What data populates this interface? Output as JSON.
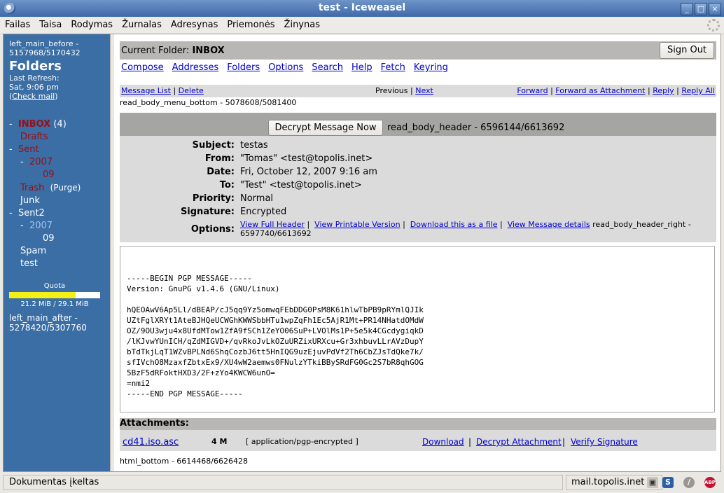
{
  "window": {
    "title": "test - Iceweasel"
  },
  "menubar": [
    "Failas",
    "Taisa",
    "Rodymas",
    "Žurnalas",
    "Adresynas",
    "Priemonės",
    "Žinynas"
  ],
  "left": {
    "debug_before": "left_main_before - 5157968/5170432",
    "title": "Folders",
    "last_refresh_label": "Last Refresh:",
    "last_refresh_value": "Sat, 9:06 pm",
    "check_mail_open": "(",
    "check_mail": "Check mail",
    "check_mail_close": ")",
    "folders": [
      {
        "prefix": "-",
        "name": "INBOX",
        "count": "(4)",
        "style": "redbold",
        "indent": 0
      },
      {
        "prefix": "",
        "name": "Drafts",
        "style": "red",
        "indent": 0
      },
      {
        "prefix": "-",
        "name": "Sent",
        "style": "red",
        "indent": 0
      },
      {
        "prefix": "-",
        "name": "2007",
        "style": "red",
        "indent": 1
      },
      {
        "prefix": "",
        "name": "09",
        "style": "red",
        "indent": 2
      },
      {
        "prefix": "",
        "name": "Trash",
        "extra": "(Purge)",
        "style": "red",
        "indent": 0
      },
      {
        "prefix": "",
        "name": "Junk",
        "style": "white",
        "indent": 0
      },
      {
        "prefix": "-",
        "name": "Sent2",
        "style": "white",
        "indent": 0
      },
      {
        "prefix": "-",
        "name": "2007",
        "style": "blueish",
        "indent": 1
      },
      {
        "prefix": "",
        "name": "09",
        "style": "white",
        "indent": 2
      },
      {
        "prefix": "",
        "name": "Spam",
        "style": "white",
        "indent": 0
      },
      {
        "prefix": "",
        "name": "test",
        "style": "white",
        "indent": 0
      }
    ],
    "quota_label": "Quota",
    "quota_fraction": 0.73,
    "quota_text": "21.2 MiB / 29.1 MiB",
    "debug_after": "left_main_after - 5278420/5307760"
  },
  "header": {
    "current_folder_label": "Current Folder:",
    "current_folder": "INBOX",
    "sign_out": "Sign Out"
  },
  "nav": [
    "Compose",
    "Addresses",
    "Folders",
    "Options",
    "Search",
    "Help",
    "Fetch",
    "Keyring"
  ],
  "msgbar": {
    "message_list": "Message List",
    "delete": "Delete",
    "previous": "Previous",
    "next": "Next",
    "forward": "Forward",
    "forward_attachment": "Forward as Attachment",
    "reply": "Reply",
    "reply_all": "Reply All",
    "sep": "|"
  },
  "debug_menu_bottom": "read_body_menu_bottom - 5078608/5081400",
  "decrypt_button": "Decrypt Message Now",
  "debug_read_body_header": "read_body_header - 6596144/6613692",
  "headers": {
    "subject_label": "Subject:",
    "subject": "testas",
    "from_label": "From:",
    "from": "\"Tomas\" <test@topolis.inet>",
    "date_label": "Date:",
    "date": "Fri, October 12, 2007 9:16 am",
    "to_label": "To:",
    "to": "\"Test\" <test@topolis.inet>",
    "priority_label": "Priority:",
    "priority": "Normal",
    "signature_label": "Signature:",
    "signature": "Encrypted",
    "options_label": "Options:",
    "view_full_header": "View Full Header",
    "view_printable": "View Printable Version",
    "download_file": "Download this as a file",
    "view_details": "View Message details",
    "debug_header_right": "read_body_header_right - 6597740/6613692"
  },
  "body_text": "-----BEGIN PGP MESSAGE-----\nVersion: GnuPG v1.4.6 (GNU/Linux)\n\nhQEOAwV6Ap5Ll/dBEAP/cJ5qq9Yz5omwqFEbDDG0PsM8K61hlwTbPB9pRYmlQJIk\nUZtFglXRYt1AteBJHQeUCWGhKWWSbbHTu1wpZqFh1Ec5AjR1Mt+PR14NHatdOMdW\nOZ/9OU3wju4x8UfdMTow1ZfA9fSCh1ZeYO06SuP+LVOlMs1P+5e5k4CGcdygiqkD\n/lKJvwYUnICH/qZdMIGVD+/qvRkoJvLkOZuURZixURXcu+Gr3xhbuvLLrAVzDupY\nbTdTkjLqT1WZvBPLNd6ShqCozbJ6tt5HnIQG9uzEjuvPdVf2Th6CbZJsTdQke7k/\nsfIVchO8MzaxfZbtxEx9/XU4wW2aemws0FNulzYTkiBBySRdFG0Gc2S7bR8qhGOG\n5BzF5dRFoktHXD3/2F+zYo4KWCW6unO=\n=nmi2\n-----END PGP MESSAGE-----",
  "attachments": {
    "title": "Attachments:",
    "name": "cd41.iso.asc",
    "size": "4 M",
    "type": "[ application/pgp-encrypted ]",
    "download": "Download",
    "decrypt": "Decrypt Attachment",
    "verify": "Verify Signature"
  },
  "debug_html_bottom": "html_bottom - 6614468/6626428",
  "status": {
    "text": "Dokumentas įkeltas",
    "host": "mail.topolis.inet"
  }
}
